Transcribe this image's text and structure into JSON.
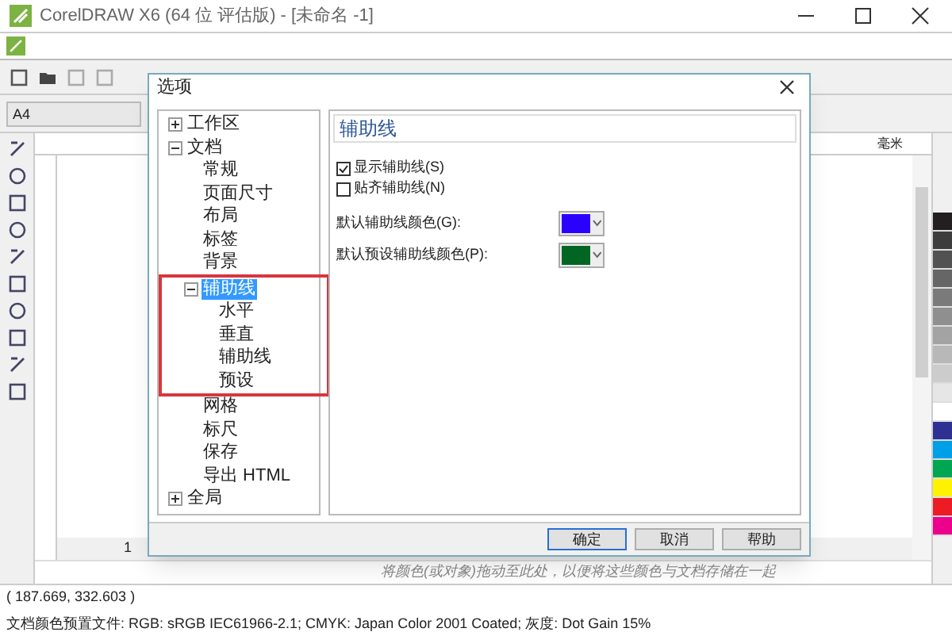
{
  "window": {
    "title": "CorelDRAW X6 (64 位 评估版) - [未命名 -1]"
  },
  "property_bar": {
    "page_size": "A4"
  },
  "ruler": {
    "unit": "毫米"
  },
  "page_nav": {
    "page": "1"
  },
  "dialog": {
    "title": "选项",
    "tree": [
      {
        "label": "工作区",
        "expanded": false,
        "selected": false
      },
      {
        "label": "文档",
        "expanded": true,
        "selected": false,
        "children": [
          {
            "label": "常规",
            "selected": false
          },
          {
            "label": "页面尺寸",
            "selected": false
          },
          {
            "label": "布局",
            "selected": false
          },
          {
            "label": "标签",
            "selected": false
          },
          {
            "label": "背景",
            "selected": false
          },
          {
            "label": "辅助线",
            "selected": true,
            "expanded": true,
            "children": [
              {
                "label": "水平",
                "selected": false
              },
              {
                "label": "垂直",
                "selected": false
              },
              {
                "label": "辅助线",
                "selected": false
              },
              {
                "label": "预设",
                "selected": false
              }
            ]
          },
          {
            "label": "网格",
            "selected": false
          },
          {
            "label": "标尺",
            "selected": false
          },
          {
            "label": "保存",
            "selected": false
          },
          {
            "label": "导出 HTML",
            "selected": false
          }
        ]
      },
      {
        "label": "全局",
        "expanded": false,
        "selected": false
      }
    ],
    "page_title": "辅助线",
    "checkboxes": [
      {
        "label": "显示辅助线(S)",
        "checked": true
      },
      {
        "label": "贴齐辅助线(N)",
        "checked": false
      }
    ],
    "color_pickers": [
      {
        "label": "默认辅助线颜色(G):",
        "color": "#2a00ff"
      },
      {
        "label": "默认预设辅助线颜色(P):",
        "color": "#006622"
      }
    ],
    "buttons": [
      {
        "label": "确定",
        "selected": true
      },
      {
        "label": "取消",
        "selected": false
      },
      {
        "label": "帮助",
        "selected": false
      }
    ]
  },
  "palette": [
    {
      "color": "#231f20"
    },
    {
      "color": "#3d3d3d"
    },
    {
      "color": "#525252"
    },
    {
      "color": "#666666"
    },
    {
      "color": "#7a7a7a"
    },
    {
      "color": "#8f8f8f"
    },
    {
      "color": "#a3a3a3"
    },
    {
      "color": "#b8b8b8"
    },
    {
      "color": "#cccccc"
    },
    {
      "color": "#e6e6e6"
    },
    {
      "color": "#ffffff"
    },
    {
      "color": "#2e3192"
    },
    {
      "color": "#00a0e9"
    },
    {
      "color": "#00a651"
    },
    {
      "color": "#fff200"
    },
    {
      "color": "#ed1c24"
    },
    {
      "color": "#ec008c"
    }
  ],
  "color_tray_hint": "将颜色(或对象)拖动至此处，以便将这些颜色与文档存储在一起",
  "status_bar": {
    "coordinates": "( 187.669, 332.603 )",
    "color_profile": "文档颜色预置文件: RGB: sRGB IEC61966-2.1; CMYK: Japan Color 2001 Coated; 灰度: Dot Gain 15%"
  }
}
